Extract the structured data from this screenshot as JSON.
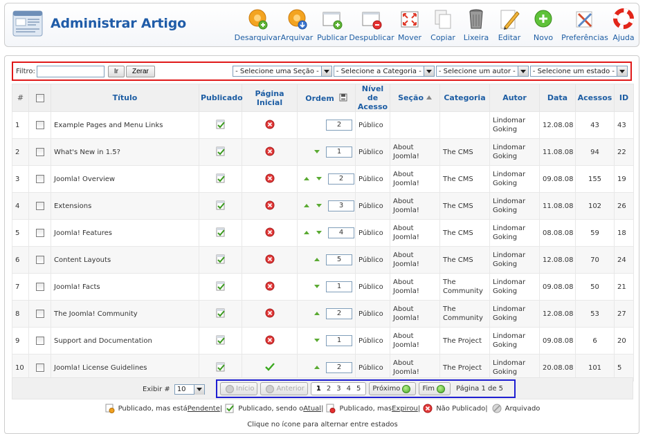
{
  "header": {
    "title": "Administrar Artigo",
    "toolbar": [
      {
        "label": "Desarquivar",
        "icon": "unarchive-icon"
      },
      {
        "label": "Arquivar",
        "icon": "archive-icon"
      },
      {
        "label": "Publicar",
        "icon": "publish-icon"
      },
      {
        "label": "Despublicar",
        "icon": "unpublish-icon"
      },
      {
        "label": "Mover",
        "icon": "move-icon"
      },
      {
        "label": "Copiar",
        "icon": "copy-icon"
      },
      {
        "label": "Lixeira",
        "icon": "trash-icon"
      },
      {
        "label": "Editar",
        "icon": "edit-icon"
      },
      {
        "label": "Novo",
        "icon": "new-icon"
      },
      {
        "label": "Preferências",
        "icon": "preferences-icon"
      },
      {
        "label": "Ajuda",
        "icon": "help-icon"
      }
    ]
  },
  "filter": {
    "label": "Filtro:",
    "value": "",
    "go_label": "Ir",
    "reset_label": "Zerar",
    "section_select": "- Selecione uma Seção -",
    "category_select": "- Selecione a Categoria -",
    "author_select": "- Selecione um autor -",
    "state_select": "- Selecione um estado -"
  },
  "table": {
    "columns": {
      "num": "#",
      "title": "Título",
      "published": "Publicado",
      "frontpage": "Página Inicial",
      "order": "Ordem",
      "access": "Nível de Acesso",
      "section": "Seção",
      "category": "Categoria",
      "author": "Autor",
      "date": "Data",
      "hits": "Acessos",
      "id": "ID"
    },
    "rows": [
      {
        "num": "1",
        "title": "Example Pages and Menu Links",
        "frontpage": false,
        "up": false,
        "down": false,
        "order": "2",
        "access": "Público",
        "section": "",
        "category": "",
        "author": "Lindomar Goking",
        "date": "12.08.08",
        "hits": "43",
        "id": "43"
      },
      {
        "num": "2",
        "title": "What's New in 1.5?",
        "frontpage": false,
        "up": false,
        "down": true,
        "order": "1",
        "access": "Público",
        "section": "About Joomla!",
        "category": "The CMS",
        "author": "Lindomar Goking",
        "date": "11.08.08",
        "hits": "94",
        "id": "22"
      },
      {
        "num": "3",
        "title": "Joomla! Overview",
        "frontpage": false,
        "up": true,
        "down": true,
        "order": "2",
        "access": "Público",
        "section": "About Joomla!",
        "category": "The CMS",
        "author": "Lindomar Goking",
        "date": "09.08.08",
        "hits": "155",
        "id": "19"
      },
      {
        "num": "4",
        "title": "Extensions",
        "frontpage": false,
        "up": true,
        "down": true,
        "order": "3",
        "access": "Público",
        "section": "About Joomla!",
        "category": "The CMS",
        "author": "Lindomar Goking",
        "date": "11.08.08",
        "hits": "102",
        "id": "26"
      },
      {
        "num": "5",
        "title": "Joomla! Features",
        "frontpage": false,
        "up": true,
        "down": true,
        "order": "4",
        "access": "Público",
        "section": "About Joomla!",
        "category": "The CMS",
        "author": "Lindomar Goking",
        "date": "08.08.08",
        "hits": "59",
        "id": "18"
      },
      {
        "num": "6",
        "title": "Content Layouts",
        "frontpage": false,
        "up": true,
        "down": false,
        "order": "5",
        "access": "Público",
        "section": "About Joomla!",
        "category": "The CMS",
        "author": "Lindomar Goking",
        "date": "12.08.08",
        "hits": "70",
        "id": "24"
      },
      {
        "num": "7",
        "title": "Joomla! Facts",
        "frontpage": false,
        "up": false,
        "down": true,
        "order": "1",
        "access": "Público",
        "section": "About Joomla!",
        "category": "The Community",
        "author": "Lindomar Goking",
        "date": "09.08.08",
        "hits": "50",
        "id": "21"
      },
      {
        "num": "8",
        "title": "The Joomla! Community",
        "frontpage": false,
        "up": true,
        "down": false,
        "order": "2",
        "access": "Público",
        "section": "About Joomla!",
        "category": "The Community",
        "author": "Lindomar Goking",
        "date": "12.08.08",
        "hits": "53",
        "id": "27"
      },
      {
        "num": "9",
        "title": "Support and Documentation",
        "frontpage": false,
        "up": false,
        "down": true,
        "order": "1",
        "access": "Público",
        "section": "About Joomla!",
        "category": "The Project",
        "author": "Lindomar Goking",
        "date": "09.08.08",
        "hits": "6",
        "id": "20"
      },
      {
        "num": "10",
        "title": "Joomla! License Guidelines",
        "frontpage": true,
        "up": true,
        "down": false,
        "order": "2",
        "access": "Público",
        "section": "About Joomla!",
        "category": "The Project",
        "author": "Lindomar Goking",
        "date": "20.08.08",
        "hits": "101",
        "id": "5"
      }
    ]
  },
  "pagination": {
    "display_label": "Exibir #",
    "display_value": "10",
    "start": "Início",
    "prev": "Anterior",
    "pages": [
      "1",
      "2",
      "3",
      "4",
      "5"
    ],
    "current": "1",
    "next": "Próximo",
    "end": "Fim",
    "info": "Página 1 de 5"
  },
  "legend": {
    "pending_prefix": "Publicado, mas está ",
    "pending_link": "Pendente",
    "current_prefix": "Publicado, sendo o ",
    "current_link": "Atual",
    "expired_prefix": "Publicado, mas ",
    "expired_link": "Expirou",
    "unpublished": "Não Publicado",
    "archived": "Arquivado",
    "sep": " |",
    "hint": "Clique no ícone para alternar entre estados"
  },
  "colors": {
    "title_blue": "#1f5ca8",
    "link_blue": "#1d5da3",
    "access_green": "#119911",
    "filter_border": "#e01818",
    "pager_border": "#1d1dd1"
  }
}
